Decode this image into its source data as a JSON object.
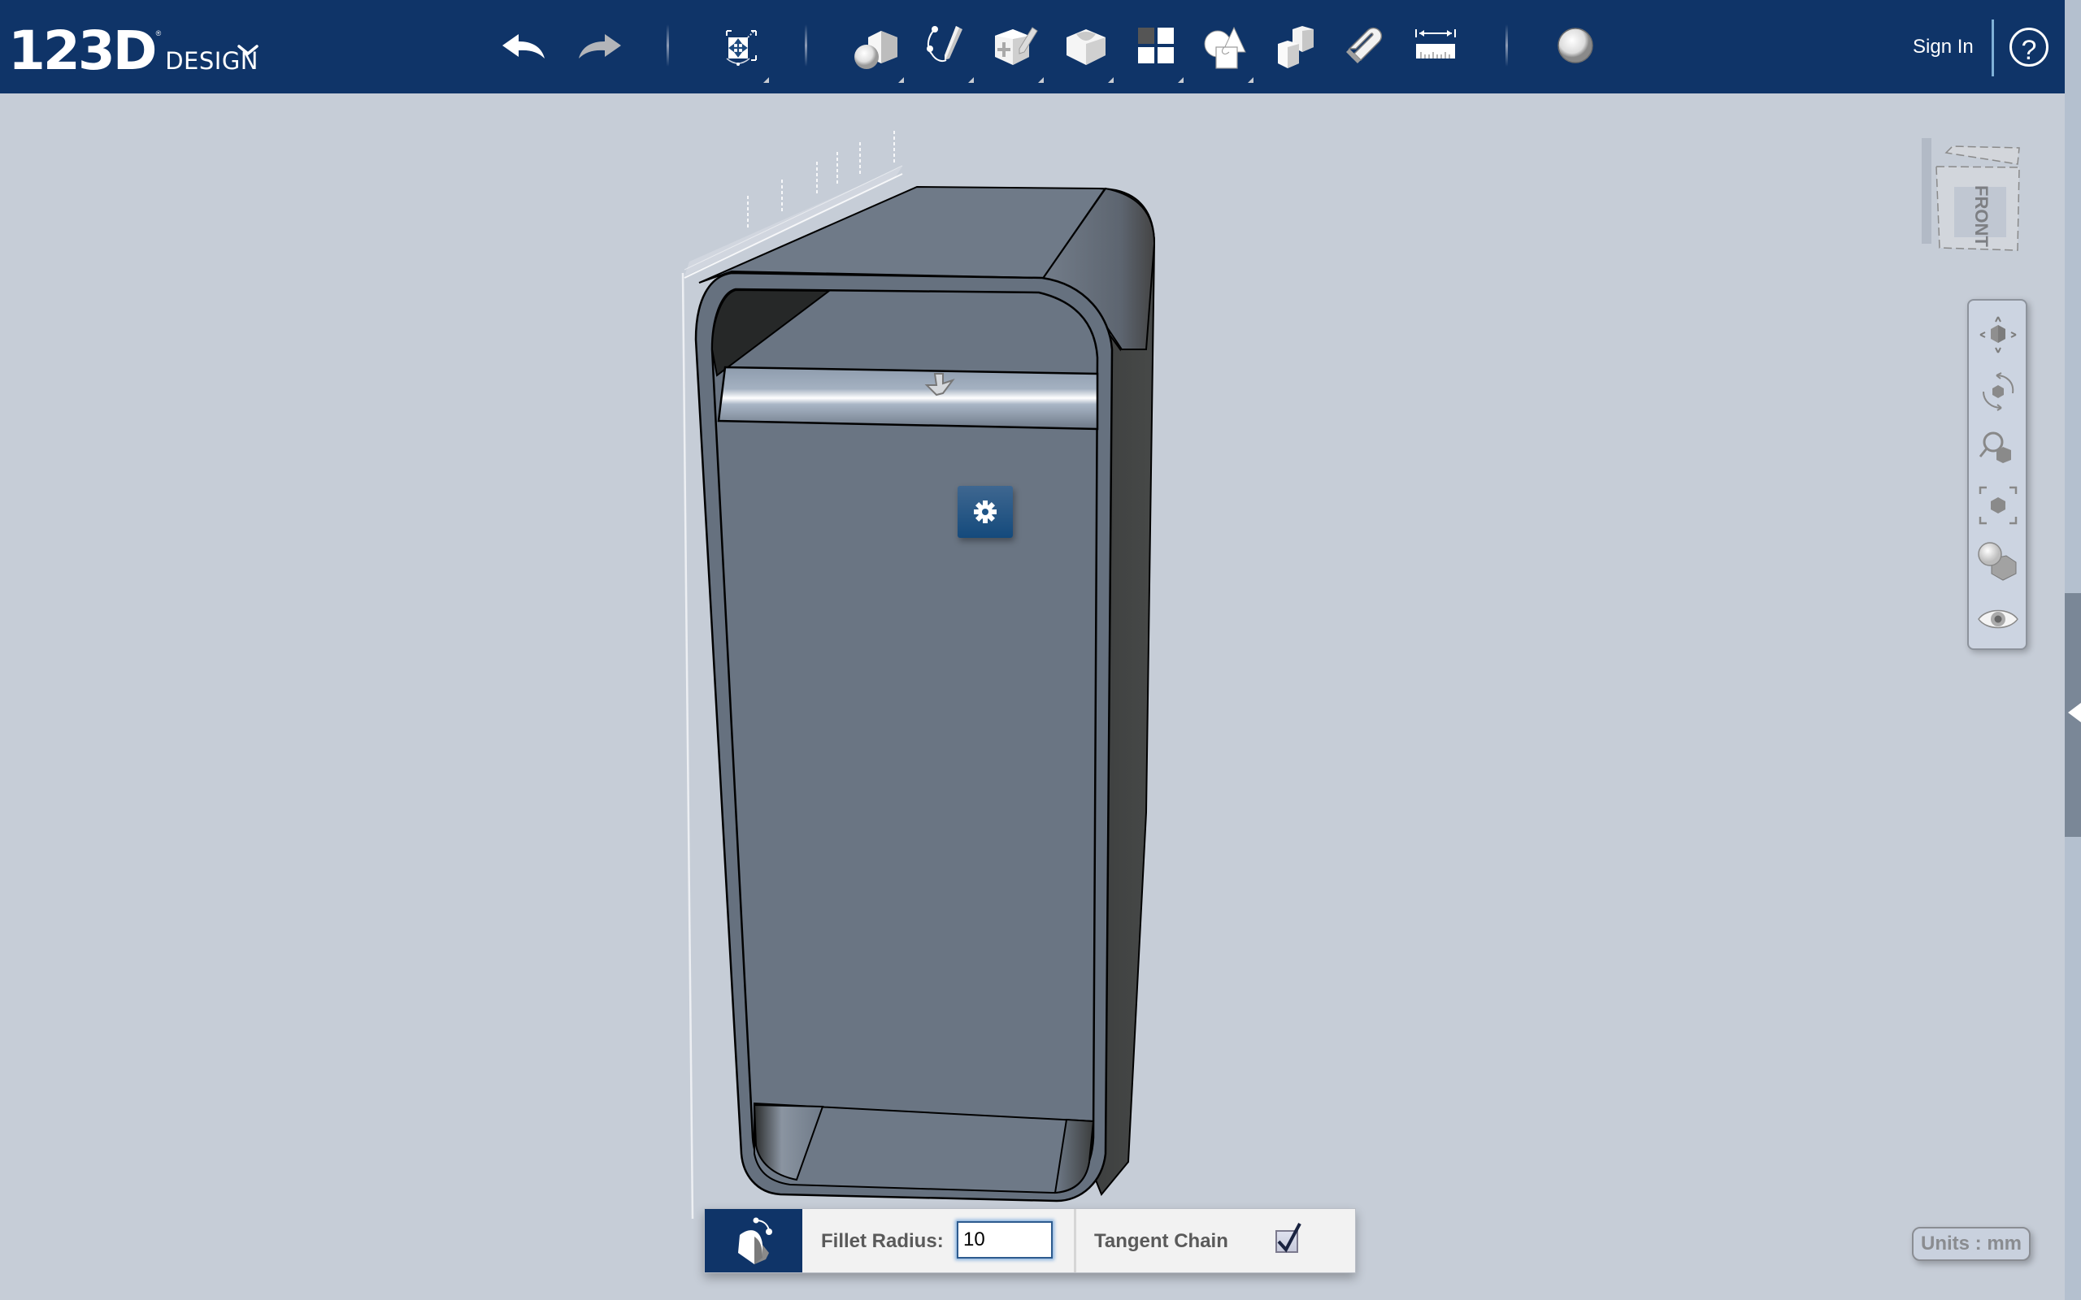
{
  "app": {
    "logo_text": "123D",
    "logo_registered": "®",
    "logo_suffix": "DESIGN"
  },
  "toolbar": {
    "items": [
      {
        "name": "undo",
        "icon": "undo-arrow-icon",
        "has_submenu": false,
        "enabled": true
      },
      {
        "name": "redo",
        "icon": "redo-arrow-icon",
        "has_submenu": false,
        "enabled": false
      },
      {
        "name": "transform",
        "icon": "transform-move-icon",
        "has_submenu": true
      },
      {
        "name": "primitives",
        "icon": "primitives-sphere-cube-icon",
        "has_submenu": true
      },
      {
        "name": "sketch",
        "icon": "sketch-pencil-icon",
        "has_submenu": true
      },
      {
        "name": "construct",
        "icon": "construct-box-pencil-icon",
        "has_submenu": true
      },
      {
        "name": "modify",
        "icon": "modify-shell-icon",
        "has_submenu": true
      },
      {
        "name": "pattern",
        "icon": "pattern-grid-icon",
        "has_submenu": true
      },
      {
        "name": "grouping",
        "icon": "combine-shapes-icon",
        "has_submenu": true
      },
      {
        "name": "combine",
        "icon": "combine-blocks-icon",
        "has_submenu": false
      },
      {
        "name": "snap",
        "icon": "snap-magnet-icon",
        "has_submenu": false
      },
      {
        "name": "measure",
        "icon": "measure-ruler-icon",
        "has_submenu": false
      },
      {
        "name": "material",
        "icon": "material-sphere-icon",
        "has_submenu": false
      }
    ],
    "sign_in_label": "Sign In",
    "help_label": "?"
  },
  "viewcube": {
    "face_label": "FRONT"
  },
  "nav_bar": {
    "items": [
      {
        "name": "pan",
        "icon": "pan-icon"
      },
      {
        "name": "orbit",
        "icon": "orbit-icon"
      },
      {
        "name": "zoom",
        "icon": "zoom-icon"
      },
      {
        "name": "fit",
        "icon": "fit-to-view-icon"
      },
      {
        "name": "view-mode",
        "icon": "material-visibility-icon"
      },
      {
        "name": "show-hide",
        "icon": "eye-icon"
      }
    ]
  },
  "fillet_panel": {
    "radius_label": "Fillet Radius:",
    "radius_value": "10",
    "tangent_chain_label": "Tangent Chain",
    "tangent_chain_checked": true
  },
  "status": {
    "units_label": "Units : mm"
  },
  "colors": {
    "topbar": "#0f3468",
    "viewport_bg": "#c6cdd7",
    "model_body": "#6b7685",
    "model_dark_side": "#404241",
    "accent_blue": "#144a7c"
  }
}
